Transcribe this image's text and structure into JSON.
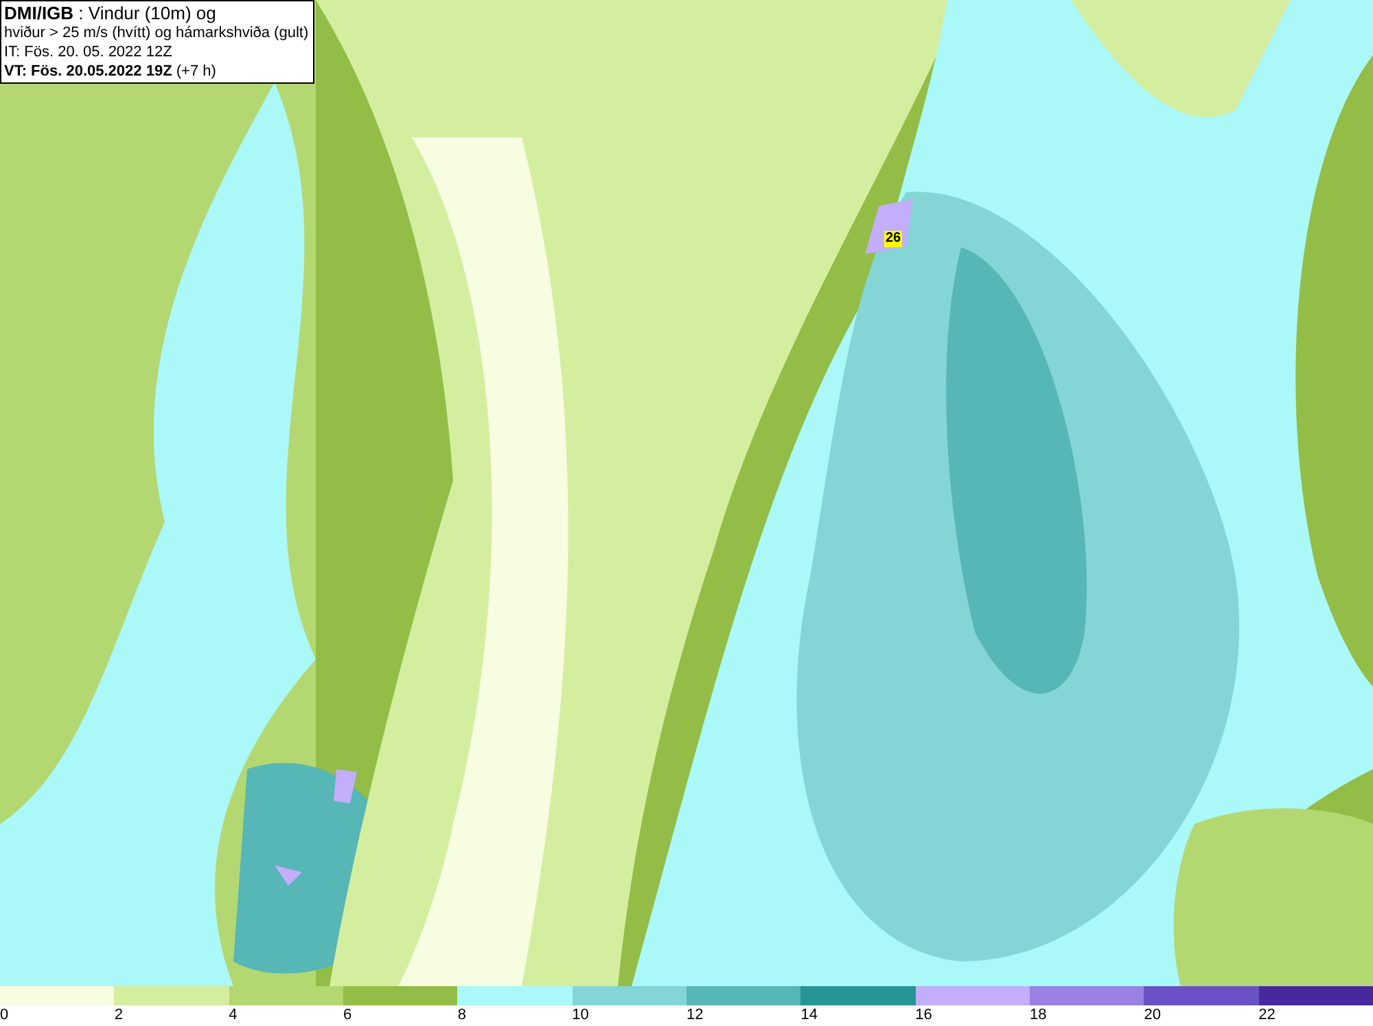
{
  "header": {
    "lines": [
      "**DMI/IGB** : Vindur (10m) og",
      "hviður > 25 m/s (hvítt) og hámarkshviða (gult)",
      "IT: Fös. 20. 05. 2022 12Z",
      "**VT: Fös. 20.05.2022 19Z** (+7 h)"
    ]
  },
  "gust_labels": [
    {
      "text": "26"
    }
  ],
  "legend": [
    {
      "label": "0",
      "color": "#f6fde0"
    },
    {
      "label": "2",
      "color": "#d4eea0"
    },
    {
      "label": "4",
      "color": "#b3d872"
    },
    {
      "label": "6",
      "color": "#93bd47"
    },
    {
      "label": "8",
      "color": "#aaf8f8"
    },
    {
      "label": "10",
      "color": "#84d6d6"
    },
    {
      "label": "12",
      "color": "#57b6b6"
    },
    {
      "label": "14",
      "color": "#279594"
    },
    {
      "label": "16",
      "color": "#c2aefa"
    },
    {
      "label": "18",
      "color": "#9a82e2"
    },
    {
      "label": "20",
      "color": "#6a52c6"
    },
    {
      "label": "22",
      "color": "#47289e"
    }
  ]
}
